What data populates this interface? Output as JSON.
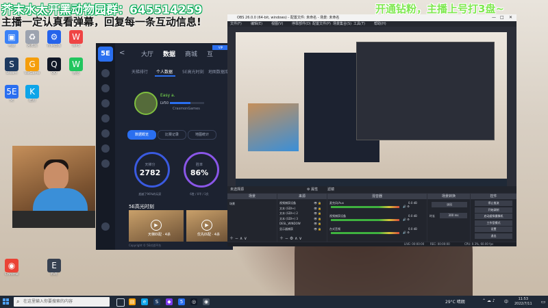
{
  "overlay": {
    "group_text": "芥末水太开黑动物园群：645514259",
    "sub_text": "主播一定认真看弹幕，回复每一条互动信息!",
    "right_text": "开通钻粉，主播上号打3盘~"
  },
  "desktop_icons": [
    {
      "label": "电脑",
      "color": "#3b82f6",
      "glyph": "▣"
    },
    {
      "label": "回收站",
      "color": "#9ca3af",
      "glyph": "♻"
    },
    {
      "label": "控制面板",
      "color": "#2563eb",
      "glyph": "⚙"
    },
    {
      "label": "WPS",
      "color": "#ef4444",
      "glyph": "W"
    },
    {
      "label": "Steam",
      "color": "#1e3a5f",
      "glyph": "S"
    },
    {
      "label": "WeGame",
      "color": "#f59e0b",
      "glyph": "G"
    },
    {
      "label": "QQ",
      "color": "#111827",
      "glyph": "Q"
    },
    {
      "label": "微信",
      "color": "#22c55e",
      "glyph": "W"
    },
    {
      "label": "5E",
      "color": "#2a6ff0",
      "glyph": "5E"
    },
    {
      "label": "酷狗",
      "color": "#0ea5e9",
      "glyph": "K"
    },
    {
      "label": "Chrome",
      "color": "#ea4335",
      "glyph": "◉"
    },
    {
      "label": "EVE",
      "color": "#374151",
      "glyph": "E"
    }
  ],
  "app5e": {
    "logo": "5E",
    "back": "<",
    "nav": [
      "大厅",
      "数据",
      "商城",
      "互"
    ],
    "nav_active": 1,
    "badge": "VIP",
    "subnav": [
      "天梯排行",
      "个人数据",
      "5E高光时刻",
      "地图数据库"
    ],
    "subnav_active": 1,
    "nickname": "Easy a.  ",
    "level": "LV50",
    "level_progress": 0.6,
    "player_id": "CrasmonGames",
    "pills": [
      "数据概览",
      "比赛记录",
      "地图统计"
    ],
    "pill_active": 0,
    "stat1_label": "天梯分",
    "stat1_value": "2782",
    "stat1_sub": "超越了96%的玩家",
    "stat2_label": "胜率",
    "stat2_value": "86%",
    "stat2_sub": "6胜 / 0平 / 1负",
    "highlights_title": "5E高光时刻",
    "videos": [
      "天梯匹配 · 4杀",
      "优先匹配 · 4杀"
    ],
    "footer": "Copyright © 5E对战平台"
  },
  "obs": {
    "title": "OBS 26.0.0 (64-bit, windows) - 配置文件: 未命名 - 场景: 未命名",
    "menu": [
      "文件(F)",
      "编辑(E)",
      "视图(V)",
      "停靠部件(D)",
      "配置文件(P)",
      "场景集合(S)",
      "工具(T)",
      "帮助(H)"
    ],
    "toolbar_label": "未选择源",
    "toolbar_props": "⚙ 属性",
    "toolbar_filters": "滤镜",
    "docks": {
      "scenes": "场景",
      "sources": "来源",
      "mixer": "混音器",
      "transitions": "场景转换",
      "controls": "控件"
    },
    "scene_items": [
      "场景"
    ],
    "source_items": [
      "视频捕获设备",
      "文本 (GDI+)",
      "文本 (GDI+) 2",
      "文本 (GDI+) 3",
      "DESL_WINDOW",
      "显示器捕获"
    ],
    "mixer_items": [
      {
        "name": "麦克风/Aux",
        "db": "0.0 dB"
      },
      {
        "name": "视频捕获设备",
        "db": "0.0 dB"
      },
      {
        "name": "台式音频",
        "db": "0.0 dB"
      }
    ],
    "transition_value": "淡出",
    "duration_label": "时长",
    "duration_value": "300 ms",
    "controls": [
      "停止推流",
      "开始录制",
      "启动虚拟摄像机",
      "工作室模式",
      "设置",
      "退出"
    ],
    "status": {
      "live": "LIVE: 00:00:00",
      "rec": "REC: 00:00:00",
      "cpu": "CPU: 0.3%, 60.00 fps"
    }
  },
  "taskbar": {
    "search_placeholder": "在这里输入你要搜索的内容",
    "weather": "29°C 晴朗",
    "lang": "中",
    "time": "11:53",
    "date": "2022/7/11"
  }
}
